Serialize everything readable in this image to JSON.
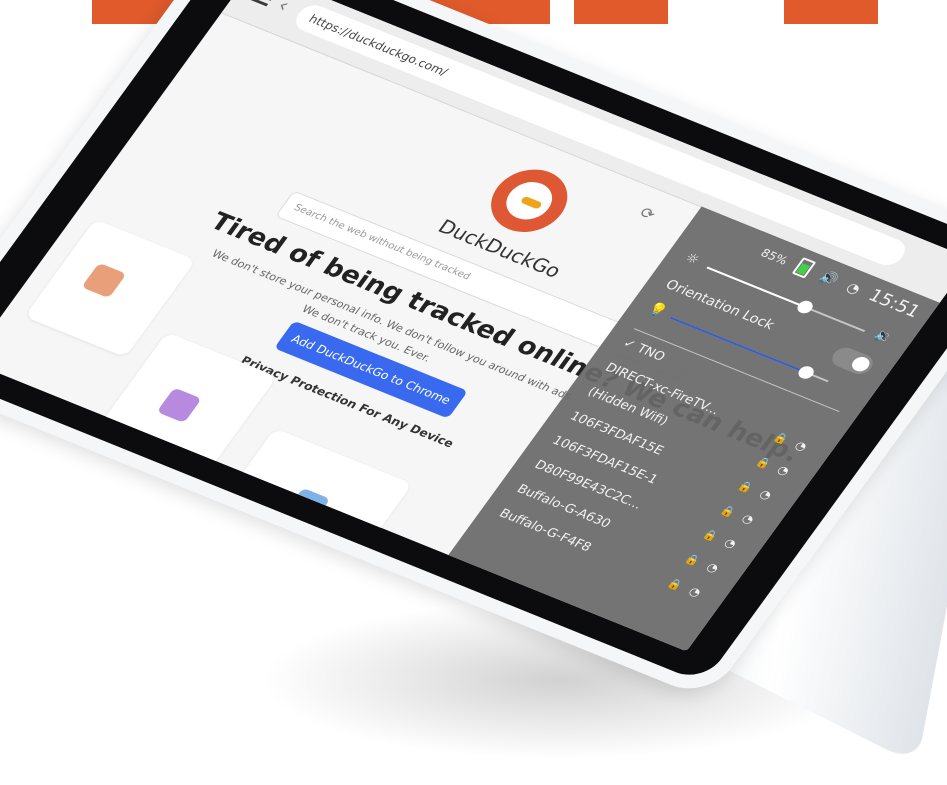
{
  "browser": {
    "url": "https://duckduckgo.com/",
    "search_placeholder": "Search the web without being tracked",
    "brand": "DuckDuckGo",
    "headline": "Tired of being tracked online? We can help.",
    "subline": "We don't store your personal info. We don't follow you around with ads.",
    "subline2": "We don't track you. Ever.",
    "cta": "Add DuckDuckGo to Chrome",
    "privacy_heading": "Privacy Protection For Any Device"
  },
  "status_bar": {
    "battery_percent": "85%",
    "time": "15:51"
  },
  "quick_settings": {
    "orientation_lock_label": "Orientation Lock",
    "brightness_level": 0.62,
    "volume_level": 0.86,
    "orientation_lock_on": true
  },
  "wifi_networks": [
    {
      "name": "TNO",
      "connected": true,
      "secured": false
    },
    {
      "name": "DIRECT-xc-FireTV...",
      "connected": false,
      "secured": true
    },
    {
      "name": "(Hidden Wifi)",
      "connected": false,
      "secured": true
    },
    {
      "name": "106F3FDAF15E",
      "connected": false,
      "secured": true
    },
    {
      "name": "106F3FDAF15E-1",
      "connected": false,
      "secured": true
    },
    {
      "name": "D80F99E43C2C...",
      "connected": false,
      "secured": true
    },
    {
      "name": "Buffalo-G-A630",
      "connected": false,
      "secured": true
    },
    {
      "name": "Buffalo-G-F4F8",
      "connected": false,
      "secured": true
    }
  ],
  "colors": {
    "brand_orange": "#de5833",
    "cta_blue": "#3969ef",
    "battery_green": "#44d14a",
    "top_accent": "#e05a2b"
  }
}
